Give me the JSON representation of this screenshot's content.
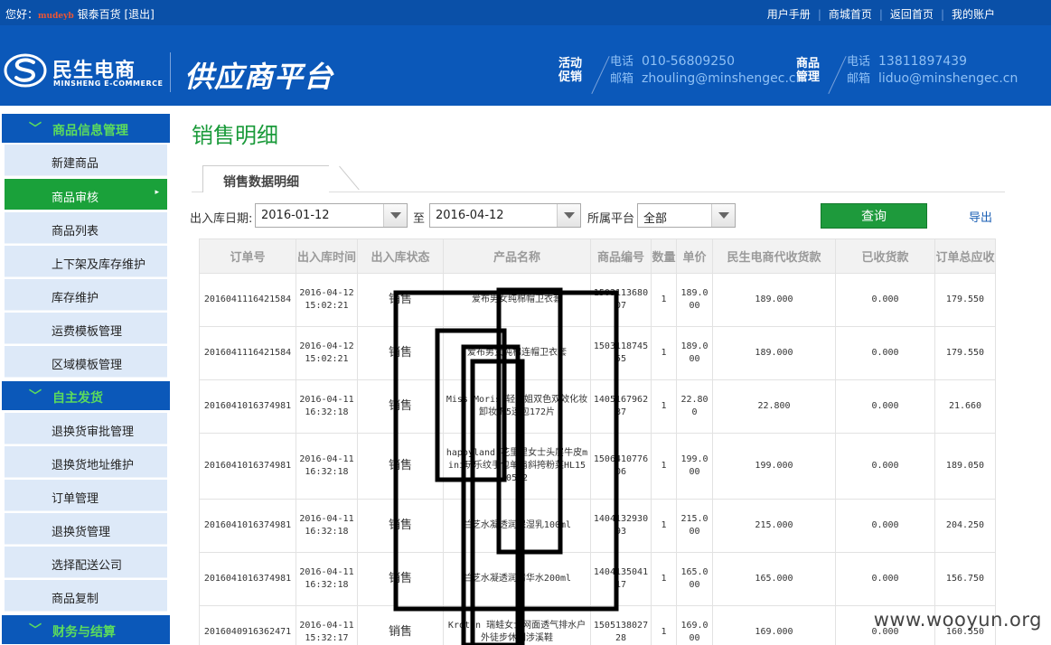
{
  "topbar": {
    "greeting": "您好：",
    "user": "mudeyb",
    "store": "银泰百货",
    "logout": "[退出]",
    "links": [
      "用户手册",
      "商城首页",
      "返回首页",
      "我的账户"
    ]
  },
  "header": {
    "logo_cn": "民生电商",
    "logo_en": "MINSHENG E-COMMERCE",
    "platform": "供应商平台",
    "promo_label_1": "活动",
    "promo_label_2": "促销",
    "goods_label_1": "商品",
    "goods_label_2": "管理",
    "phone_key": "电话",
    "mail_key": "邮箱",
    "promo_phone": "010-56809250",
    "promo_mail": "zhouling@minshengec.cn",
    "goods_phone": "13811897439",
    "goods_mail": "liduo@minshengec.cn"
  },
  "sidebar": {
    "sections": [
      {
        "title": "商品信息管理",
        "items": [
          "新建商品",
          "商品审核",
          "商品列表",
          "上下架及库存维护",
          "库存维护",
          "运费模板管理",
          "区域模板管理"
        ]
      },
      {
        "title": "自主发货",
        "items": [
          "退换货审批管理",
          "退换货地址维护",
          "订单管理",
          "退换货管理",
          "选择配送公司",
          "商品复制"
        ]
      },
      {
        "title": "财务与结算",
        "items": []
      }
    ],
    "active_item": "商品审核"
  },
  "main": {
    "title": "销售明细",
    "tab": "销售数据明细",
    "filter": {
      "date_label": "出入库日期:",
      "start": "2016-01-12",
      "to_label": "至",
      "end": "2016-04-12",
      "platform_label": "所属平台",
      "platform": "全部",
      "query": "查询",
      "export": "导出"
    }
  },
  "table": {
    "headers": [
      "订单号",
      "出入库时间",
      "出入库状态",
      "产品名称",
      "商品编号",
      "数量",
      "单价",
      "民生电商代收货款",
      "已收货款",
      "订单总应收"
    ],
    "rows": [
      {
        "order": "2016041116421584",
        "date": "2016-04-12",
        "time": "15:02:21",
        "state": "销售",
        "name": "爱布男女纯棉帽卫衣套",
        "code": "150311368007",
        "qty": "1",
        "price": "189.000",
        "collect": "189.000",
        "received": "0.000",
        "total": "179.550"
      },
      {
        "order": "2016041116421584",
        "date": "2016-04-12",
        "time": "15:02:21",
        "state": "销售",
        "name": "爱布男女纯棉连帽卫衣套",
        "code": "150311874555",
        "qty": "1",
        "price": "189.000",
        "collect": "189.000",
        "received": "0.000",
        "total": "179.550"
      },
      {
        "order": "2016041016374981",
        "date": "2016-04-11",
        "time": "16:32:18",
        "state": "销售",
        "name": "Miss Moris 轻小姐双色双效化妆卸妆棉5连包172片",
        "code": "140516796287",
        "qty": "1",
        "price": "22.800",
        "collect": "22.800",
        "received": "0.000",
        "total": "21.660"
      },
      {
        "order": "2016041016374981",
        "date": "2016-04-11",
        "time": "16:32:18",
        "state": "销售",
        "name": "happyland 花里里女士头层牛皮mini玩乐纹手包单肩斜挎粉菜HL150502",
        "code": "150641077606",
        "qty": "1",
        "price": "199.000",
        "collect": "199.000",
        "received": "0.000",
        "total": "189.050"
      },
      {
        "order": "2016041016374981",
        "date": "2016-04-11",
        "time": "16:32:18",
        "state": "销售",
        "name": "兰芝水凝透润保湿乳100ml",
        "code": "140413293093",
        "qty": "1",
        "price": "215.000",
        "collect": "215.000",
        "received": "0.000",
        "total": "204.250"
      },
      {
        "order": "2016041016374981",
        "date": "2016-04-11",
        "time": "16:32:18",
        "state": "销售",
        "name": "兰芝水凝透润精华水200ml",
        "code": "140413504117",
        "qty": "1",
        "price": "165.000",
        "collect": "165.000",
        "received": "0.000",
        "total": "156.750"
      },
      {
        "order": "2016040916362471",
        "date": "2016-04-11",
        "time": "15:32:17",
        "state": "销售",
        "name": "Kroten 瑞蛙女士网面透气排水户外徒步休闲涉溪鞋",
        "code": "150513802728",
        "qty": "1",
        "price": "169.000",
        "collect": "169.000",
        "received": "0.000",
        "total": "160.550"
      }
    ]
  },
  "watermark": "www.wooyun.org",
  "colors": {
    "header_blue": "#0b58b9",
    "accent_green": "#1aa13a",
    "title_green": "#1a9a3a"
  }
}
